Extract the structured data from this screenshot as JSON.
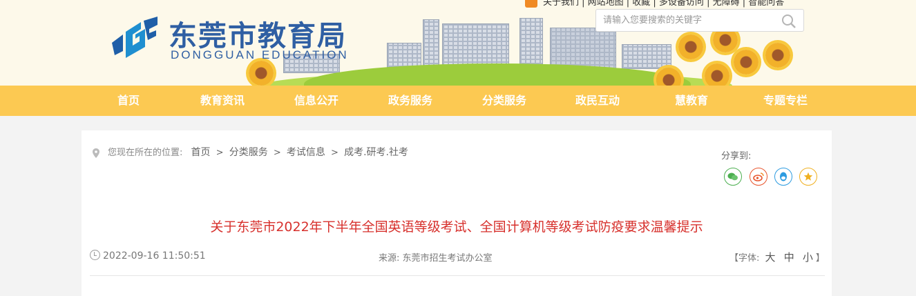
{
  "header": {
    "logo_cn": "东莞市教育局",
    "logo_en": "DONGGUAN EDUCATION",
    "top_links": "关于我们 | 网站地图 | 收藏 | 多设备访问 | 无障碍 | 智能问答",
    "search_placeholder": "请输入您要搜索的关键字"
  },
  "nav": {
    "items": [
      "首页",
      "教育资讯",
      "信息公开",
      "政务服务",
      "分类服务",
      "政民互动",
      "慧教育",
      "专题专栏"
    ]
  },
  "location": {
    "label": "您现在所在的位置:",
    "crumbs": [
      "首页",
      "分类服务",
      "考试信息",
      "成考.研考.社考"
    ],
    "separator": ">"
  },
  "share": {
    "label": "分享到:",
    "icons": [
      "wechat-icon",
      "weibo-icon",
      "qq-icon",
      "favorite-icon"
    ],
    "colors": {
      "wechat": "#4caf50",
      "weibo": "#e8542c",
      "qq": "#2c9be0",
      "favorite": "#f0b020"
    }
  },
  "article": {
    "title": "关于东莞市2022年下半年全国英语等级考试、全国计算机等级考试防疫要求温馨提示",
    "date": "2022-09-16 11:50:51",
    "source_label": "来源:",
    "source": "东莞市招生考试办公室",
    "font_label_open": "【字体:",
    "font_sizes": [
      "大",
      "中",
      "小"
    ],
    "font_label_close": "】"
  },
  "colors": {
    "nav_bg": "#fcc952",
    "title": "#d7302c",
    "brand_blue": "#2f5fa3"
  }
}
